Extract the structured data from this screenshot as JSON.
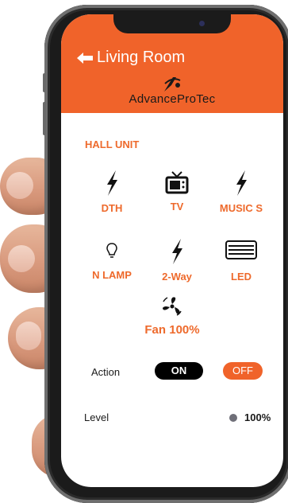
{
  "header": {
    "title": "Living Room",
    "back_icon": "back-arrow-icon",
    "logo_text": "AdvanceProTec",
    "logo_icon": "advanceprotec-logo"
  },
  "section": {
    "title": "HALL UNIT"
  },
  "devices": [
    {
      "label": "DTH",
      "icon": "bolt-icon"
    },
    {
      "label": "TV",
      "icon": "tv-icon"
    },
    {
      "label": "MUSIC S",
      "icon": "bolt-icon"
    },
    {
      "label": "N LAMP",
      "icon": "lightbulb-icon"
    },
    {
      "label": "2-Way",
      "icon": "bolt-icon"
    },
    {
      "label": "LED",
      "icon": "air-conditioner-icon"
    }
  ],
  "fan": {
    "label": "Fan 100%",
    "icon": "fan-icon"
  },
  "action": {
    "label": "Action",
    "on_label": "ON",
    "off_label": "OFF"
  },
  "level": {
    "label": "Level",
    "value": "100%"
  },
  "colors": {
    "accent": "#f0632a",
    "on_button": "#000000",
    "text": "#1a1a1a"
  }
}
